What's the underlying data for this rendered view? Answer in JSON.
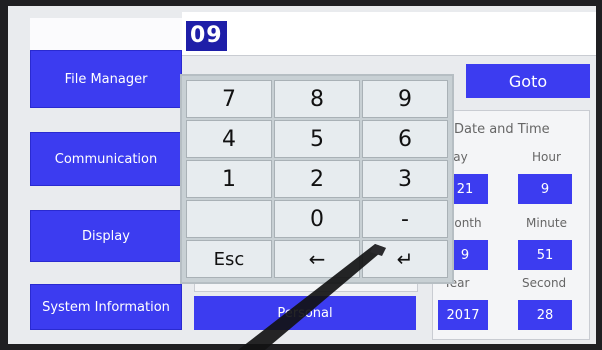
{
  "sidebar": {
    "items": [
      {
        "label": "File Manager"
      },
      {
        "label": "Communication"
      },
      {
        "label": "Display"
      },
      {
        "label": "System Information"
      }
    ]
  },
  "entry": {
    "value": "09"
  },
  "keypad": {
    "rows": [
      [
        "7",
        "8",
        "9"
      ],
      [
        "4",
        "5",
        "6"
      ],
      [
        "1",
        "2",
        "3"
      ],
      [
        "",
        "0",
        "-"
      ],
      [
        "Esc",
        "←",
        "↵"
      ]
    ]
  },
  "goto_label": "Goto",
  "datetime": {
    "title": "Date and Time",
    "day_label": "Day",
    "hour_label": "Hour",
    "day": "21",
    "hour": "9",
    "month_label": "Month",
    "minute_label": "Minute",
    "month": "9",
    "minute": "51",
    "year_label": "Year",
    "second_label": "Second",
    "year": "2017",
    "second": "28"
  },
  "bottom_button_label": "Personal",
  "colors": {
    "accent": "#3c3cf0",
    "entry_highlight": "#1e1ea8"
  }
}
